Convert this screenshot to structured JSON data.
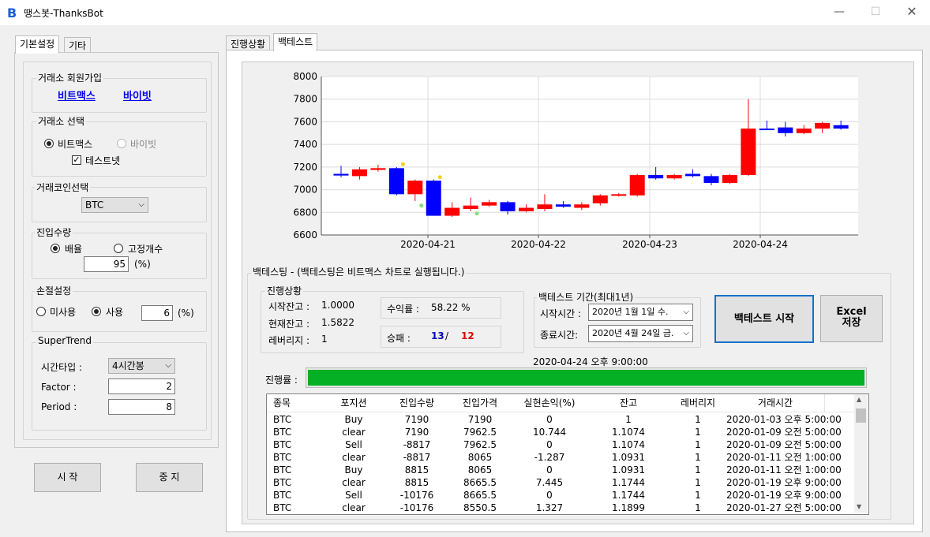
{
  "window": {
    "title": "땡스봇-ThanksBot",
    "logo": "B",
    "min": "—",
    "max": "☐",
    "close": "✕"
  },
  "left_tabs": [
    {
      "label": "기본설정"
    },
    {
      "label": "기타"
    }
  ],
  "signup": {
    "title": "거래소 회원가입",
    "bitmex": "비트맥스",
    "bybit": "바이빗"
  },
  "exchange": {
    "title": "거래소 선택",
    "bitmex": "비트맥스",
    "bybit": "바이빗",
    "testnet": "테스트넷"
  },
  "coin": {
    "title": "거래코인선택",
    "value": "BTC"
  },
  "entry": {
    "title": "진입수량",
    "multiplier": "배율",
    "fixed": "고정개수",
    "value": "95",
    "unit": "(%)"
  },
  "stoploss": {
    "title": "손절설정",
    "unused": "미사용",
    "used": "사용",
    "value": "6",
    "unit": "(%)"
  },
  "supertrend": {
    "title": "SuperTrend",
    "timeframe_label": "시간타입 :",
    "timeframe_value": "4시간봉",
    "factor_label": "Factor :",
    "factor_value": "2",
    "period_label": "Period :",
    "period_value": "8"
  },
  "buttons": {
    "start": "시 작",
    "stop": "중 지"
  },
  "right_tabs": [
    {
      "label": "진행상황"
    },
    {
      "label": "백테스트"
    }
  ],
  "chart_data": {
    "type": "candlestick",
    "ylim": [
      6600,
      8000
    ],
    "yticks": [
      "8000",
      "7800",
      "7600",
      "7400",
      "7200",
      "7000",
      "6800",
      "6600"
    ],
    "xticks": [
      "2020-04-21",
      "2020-04-22",
      "2020-04-23",
      "2020-04-24"
    ],
    "candles": [
      {
        "o": 7125,
        "c": 7140,
        "h": 7210,
        "l": 7110,
        "color": "blue"
      },
      {
        "o": 7120,
        "c": 7180,
        "h": 7200,
        "l": 7090,
        "color": "red"
      },
      {
        "o": 7175,
        "c": 7190,
        "h": 7220,
        "l": 7160,
        "color": "red"
      },
      {
        "o": 7190,
        "c": 6960,
        "h": 7200,
        "l": 6950,
        "color": "blue"
      },
      {
        "o": 6960,
        "c": 7080,
        "h": 7090,
        "l": 6900,
        "color": "red"
      },
      {
        "o": 7080,
        "c": 6770,
        "h": 7090,
        "l": 6770,
        "color": "blue"
      },
      {
        "o": 6770,
        "c": 6840,
        "h": 6890,
        "l": 6760,
        "color": "red"
      },
      {
        "o": 6830,
        "c": 6860,
        "h": 6930,
        "l": 6810,
        "color": "red"
      },
      {
        "o": 6860,
        "c": 6890,
        "h": 6910,
        "l": 6850,
        "color": "red"
      },
      {
        "o": 6890,
        "c": 6810,
        "h": 6900,
        "l": 6780,
        "color": "blue"
      },
      {
        "o": 6810,
        "c": 6840,
        "h": 6870,
        "l": 6800,
        "color": "red"
      },
      {
        "o": 6830,
        "c": 6870,
        "h": 6960,
        "l": 6810,
        "color": "red"
      },
      {
        "o": 6870,
        "c": 6850,
        "h": 6900,
        "l": 6840,
        "color": "blue"
      },
      {
        "o": 6840,
        "c": 6870,
        "h": 6890,
        "l": 6820,
        "color": "red"
      },
      {
        "o": 6880,
        "c": 6950,
        "h": 6960,
        "l": 6860,
        "color": "red"
      },
      {
        "o": 6950,
        "c": 6960,
        "h": 6970,
        "l": 6940,
        "color": "red"
      },
      {
        "o": 6950,
        "c": 7130,
        "h": 7140,
        "l": 6940,
        "color": "red"
      },
      {
        "o": 7130,
        "c": 7100,
        "h": 7200,
        "l": 7090,
        "color": "blue"
      },
      {
        "o": 7100,
        "c": 7130,
        "h": 7140,
        "l": 7090,
        "color": "red"
      },
      {
        "o": 7140,
        "c": 7120,
        "h": 7180,
        "l": 7110,
        "color": "blue"
      },
      {
        "o": 7120,
        "c": 7060,
        "h": 7140,
        "l": 7040,
        "color": "blue"
      },
      {
        "o": 7060,
        "c": 7130,
        "h": 7140,
        "l": 7050,
        "color": "red"
      },
      {
        "o": 7130,
        "c": 7540,
        "h": 7800,
        "l": 7120,
        "color": "red"
      },
      {
        "o": 7540,
        "c": 7530,
        "h": 7610,
        "l": 7530,
        "color": "blue"
      },
      {
        "o": 7550,
        "c": 7500,
        "h": 7600,
        "l": 7470,
        "color": "blue"
      },
      {
        "o": 7500,
        "c": 7540,
        "h": 7570,
        "l": 7490,
        "color": "red"
      },
      {
        "o": 7540,
        "c": 7590,
        "h": 7600,
        "l": 7500,
        "color": "red"
      },
      {
        "o": 7570,
        "c": 7540,
        "h": 7610,
        "l": 7530,
        "color": "blue"
      }
    ],
    "markers": [
      {
        "i": 3,
        "v": 7225,
        "color": "yellow"
      },
      {
        "i": 4,
        "v": 6860,
        "color": "green"
      },
      {
        "i": 5,
        "v": 7110,
        "color": "yellow"
      },
      {
        "i": 7,
        "v": 6790,
        "color": "green"
      }
    ]
  },
  "backtest": {
    "title": "백테스팅 - (백테스팅은 비트맥스 차트로 실행됩니다.)",
    "progress_group": "진행상황",
    "start_balance_label": "시작잔고 :",
    "start_balance": "1.0000",
    "current_balance_label": "현재잔고 :",
    "current_balance": "1.5822",
    "leverage_label": "레버리지 :",
    "leverage": "1",
    "return_label": "수익률 :",
    "return_value": "58.22 %",
    "winloss_label": "승패 :",
    "wins": "13",
    "slash": "/",
    "losses": "12",
    "period_group": "백테스트 기간(최대1년)",
    "start_time_label": "시작시간 :",
    "start_time": "2020년   1월   1일 수.",
    "end_time_label": "종료시간:",
    "end_time": "2020년   4월 24일 금.",
    "run_button": "백테스트 시작",
    "excel_button_line1": "Excel",
    "excel_button_line2": "저장",
    "current_time": "2020-04-24 오후 9:00:00",
    "progress_label": "진행률 :",
    "progress": 1.0
  },
  "table": {
    "headers": [
      "종목",
      "포지션",
      "진입수량",
      "진입가격",
      "실현손익(%)",
      "잔고",
      "레버리지",
      "거래시간"
    ],
    "rows": [
      [
        "BTC",
        "Buy",
        "7190",
        "7190",
        "0",
        "1",
        "1",
        "2020-01-03 오후 5:00:00"
      ],
      [
        "BTC",
        "clear",
        "7190",
        "7962.5",
        "10.744",
        "1.1074",
        "1",
        "2020-01-09 오전 5:00:00"
      ],
      [
        "BTC",
        "Sell",
        "-8817",
        "7962.5",
        "0",
        "1.1074",
        "1",
        "2020-01-09 오전 5:00:00"
      ],
      [
        "BTC",
        "clear",
        "-8817",
        "8065",
        "-1.287",
        "1.0931",
        "1",
        "2020-01-11 오전 1:00:00"
      ],
      [
        "BTC",
        "Buy",
        "8815",
        "8065",
        "0",
        "1.0931",
        "1",
        "2020-01-11 오전 1:00:00"
      ],
      [
        "BTC",
        "clear",
        "8815",
        "8665.5",
        "7.445",
        "1.1744",
        "1",
        "2020-01-19 오후 9:00:00"
      ],
      [
        "BTC",
        "Sell",
        "-10176",
        "8665.5",
        "0",
        "1.1744",
        "1",
        "2020-01-19 오후 9:00:00"
      ],
      [
        "BTC",
        "clear",
        "-10176",
        "8550.5",
        "1.327",
        "1.1899",
        "1",
        "2020-01-27 오전 5:00:00"
      ]
    ]
  },
  "colors": {
    "up": "#ff0000",
    "down": "#0000ff",
    "progress": "#06b025",
    "win": "#0000c0",
    "loss": "#e00000"
  }
}
